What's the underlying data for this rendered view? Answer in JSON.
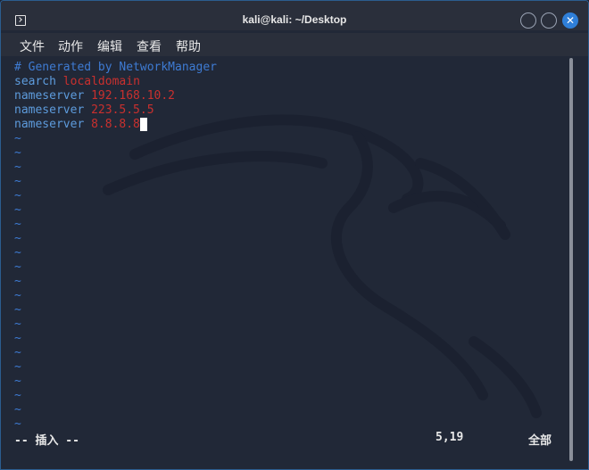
{
  "window": {
    "title": "kali@kali: ~/Desktop",
    "icon": "terminal-icon",
    "controls": [
      "minimize-icon",
      "maximize-icon",
      "close-icon"
    ],
    "close_glyph": "✕"
  },
  "menu": {
    "items": [
      "文件",
      "动作",
      "编辑",
      "查看",
      "帮助"
    ]
  },
  "editor": {
    "lines": [
      {
        "parts": [
          {
            "text": "# Generated by NetworkManager",
            "cls": "c-comment"
          }
        ]
      },
      {
        "parts": [
          {
            "text": "search ",
            "cls": "c-key"
          },
          {
            "text": "localdomain",
            "cls": "c-val"
          }
        ]
      },
      {
        "parts": [
          {
            "text": "nameserver ",
            "cls": "c-key"
          },
          {
            "text": "192.168.10.2",
            "cls": "c-val"
          }
        ]
      },
      {
        "parts": [
          {
            "text": "nameserver ",
            "cls": "c-key"
          },
          {
            "text": "223.5.5.5",
            "cls": "c-val"
          }
        ]
      },
      {
        "parts": [
          {
            "text": "nameserver ",
            "cls": "c-key"
          },
          {
            "text": "8.8.8.8",
            "cls": "c-val"
          }
        ],
        "cursor": true
      }
    ],
    "tilde": "~",
    "tilde_rows": 21,
    "mode": "-- 插入 --",
    "position": "5,19",
    "scroll": "全部"
  },
  "colors": {
    "background": "#212837",
    "comment": "#3e7bd3",
    "keyword": "#5d9bdc",
    "value": "#c9302e",
    "accent": "#2f7fd8"
  }
}
